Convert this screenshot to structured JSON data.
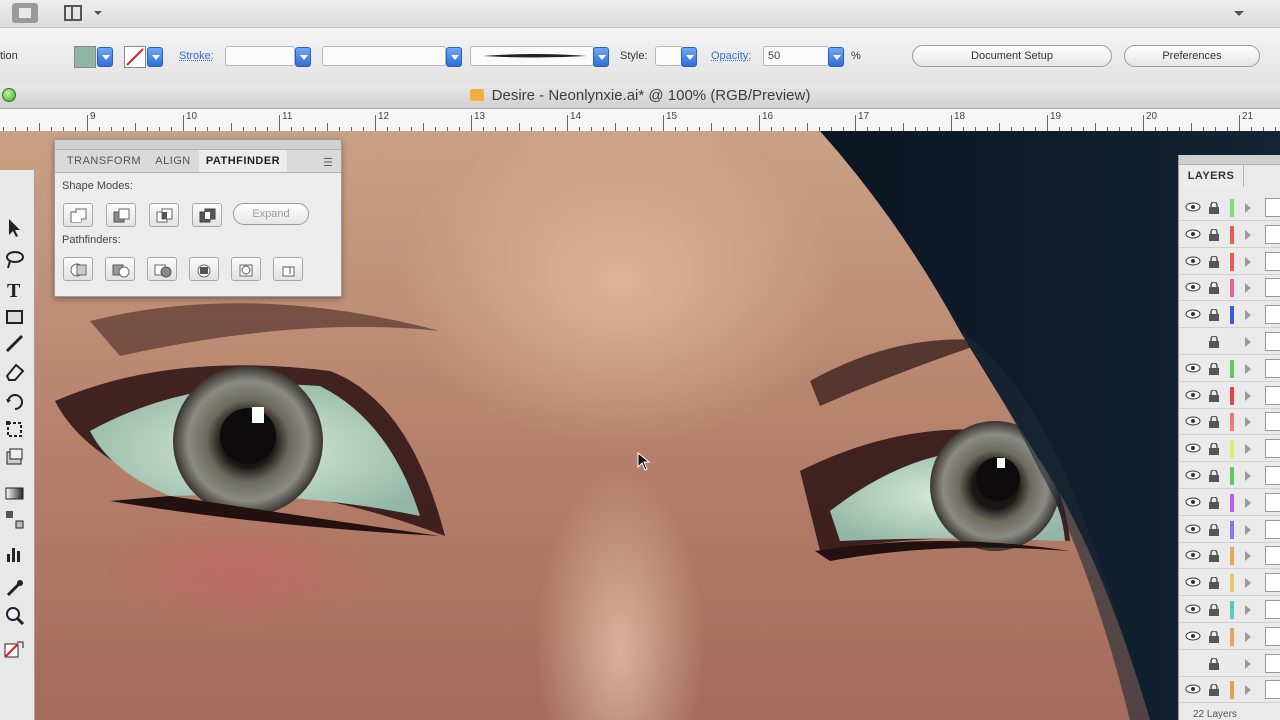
{
  "app_bar": {
    "icons": [
      "home-icon",
      "layout-icon",
      "chevron-down-icon"
    ]
  },
  "control_bar": {
    "label_left": "tion",
    "stroke_label": "Stroke:",
    "style_label": "Style:",
    "opacity_label": "Opacity:",
    "opacity_value": "50",
    "opacity_unit": "%",
    "document_setup_label": "Document Setup",
    "preferences_label": "Preferences",
    "fill_color": "#8fb6a6"
  },
  "document": {
    "title": "Desire - Neonlynxie.ai* @ 100% (RGB/Preview)"
  },
  "ruler": {
    "numbers": [
      "9",
      "10",
      "11",
      "12",
      "13",
      "14",
      "15",
      "16",
      "17",
      "18",
      "19",
      "20",
      "21"
    ]
  },
  "pathfinder_panel": {
    "tabs": [
      "TRANSFORM",
      "ALIGN",
      "PATHFINDER"
    ],
    "active_tab": "PATHFINDER",
    "shape_modes_label": "Shape Modes:",
    "expand_label": "Expand",
    "pathfinders_label": "Pathfinders:",
    "shape_mode_icons": [
      "unite-icon",
      "minus-front-icon",
      "intersect-icon",
      "exclude-icon"
    ],
    "pathfinder_icons": [
      "divide-icon",
      "trim-icon",
      "merge-icon",
      "crop-icon",
      "outline-icon",
      "minus-back-icon"
    ]
  },
  "layers_panel": {
    "title": "LAYERS",
    "count_label": "22 Layers",
    "rows": [
      {
        "color": "#7be07b"
      },
      {
        "color": "#e85a5a"
      },
      {
        "color": "#e85a5a"
      },
      {
        "color": "#e860a8"
      },
      {
        "color": "#3a5ad8"
      },
      {
        "color": "#e8e8e8"
      },
      {
        "color": "#5fc85f"
      },
      {
        "color": "#d84848"
      },
      {
        "color": "#e87a7a"
      },
      {
        "color": "#e8e868"
      },
      {
        "color": "#5fc85f"
      },
      {
        "color": "#b860e8"
      },
      {
        "color": "#7a7ae8"
      },
      {
        "color": "#e8a850"
      },
      {
        "color": "#e8c870"
      },
      {
        "color": "#58c8c8"
      },
      {
        "color": "#e8a060"
      },
      {
        "color": "#e8e8e8"
      },
      {
        "color": "#e8a050"
      }
    ]
  },
  "toolbar": {
    "tools": [
      "selection-tool-icon",
      "lasso-tool-icon",
      "type-tool-icon",
      "rectangle-tool-icon",
      "pencil-tool-icon",
      "eraser-tool-icon",
      "rotate-tool-icon",
      "free-transform-tool-icon",
      "symbol-tool-icon",
      "gradient-tool-icon",
      "blend-tool-icon",
      "graph-tool-icon",
      "eyedropper-tool-icon",
      "zoom-tool-icon",
      "fill-stroke-icon"
    ]
  }
}
